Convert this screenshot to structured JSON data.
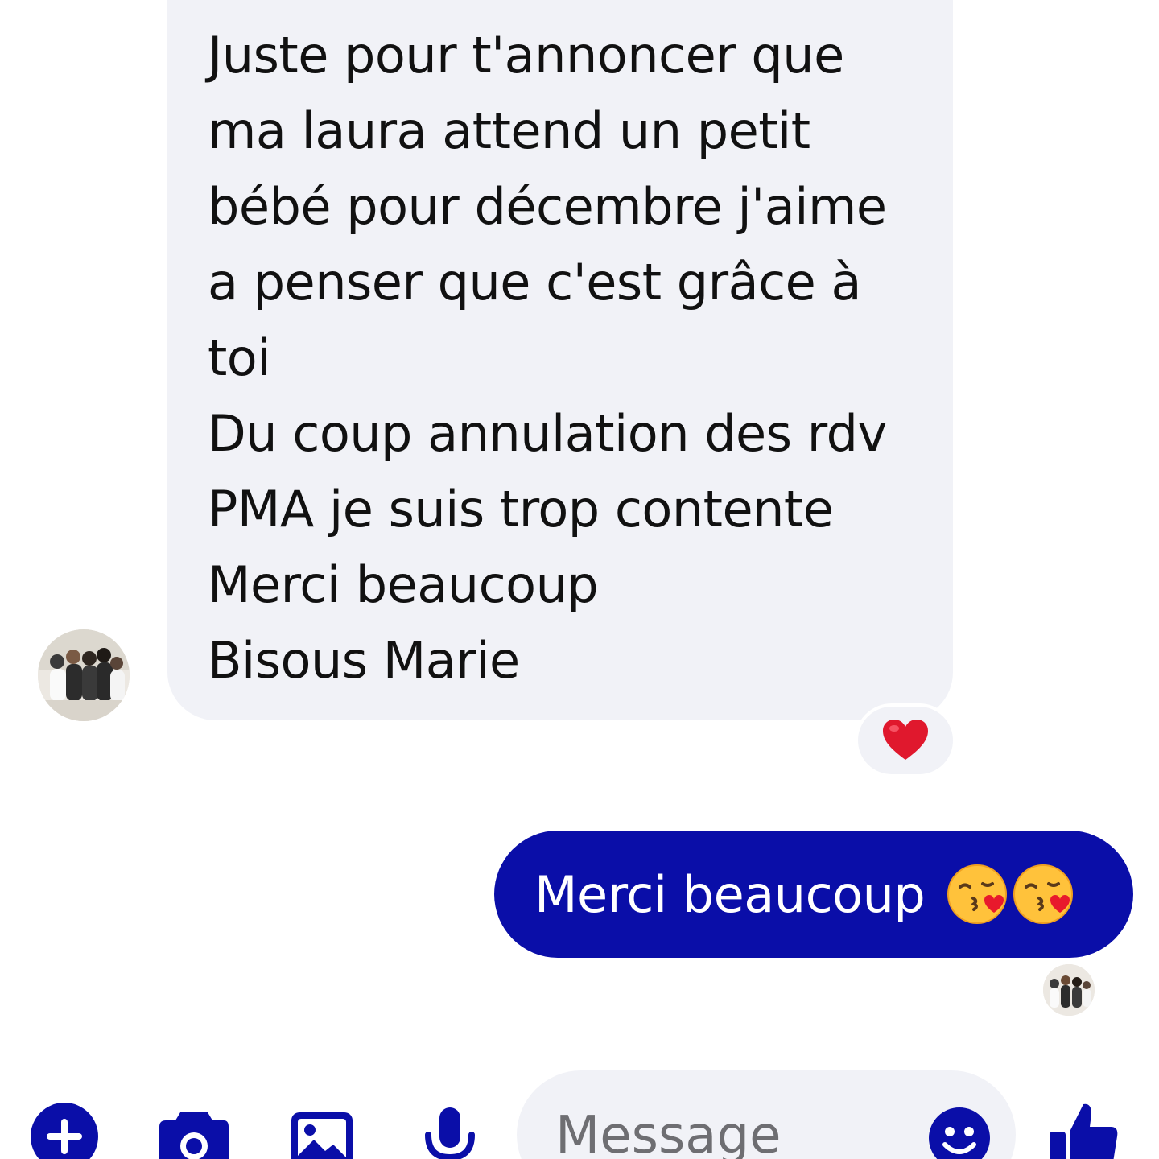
{
  "conversation": {
    "incoming_message": {
      "lines": [
        "Juste pour t'annoncer que",
        "ma laura attend un petit",
        "bébé pour décembre j'aime",
        "a penser que c'est grâce à",
        "toi",
        "Du coup annulation des rdv",
        "PMA je suis trop contente",
        "Merci beaucoup",
        "Bisous Marie"
      ],
      "reaction_icon": "red-heart-icon"
    },
    "outgoing_message": {
      "text": "Merci beaucoup",
      "emojis": [
        "kissing-face-with-heart-icon",
        "kissing-face-with-heart-icon"
      ]
    }
  },
  "composer": {
    "tools": [
      "plus-icon",
      "camera-icon",
      "image-icon",
      "microphone-icon"
    ],
    "placeholder": "Message",
    "emoji_icon": "smiley-icon",
    "send_icon": "thumbs-up-icon"
  },
  "colors": {
    "accent": "#0a0ea8",
    "incoming_bubble": "#f1f2f7",
    "reaction_heart": "#e0182d"
  }
}
